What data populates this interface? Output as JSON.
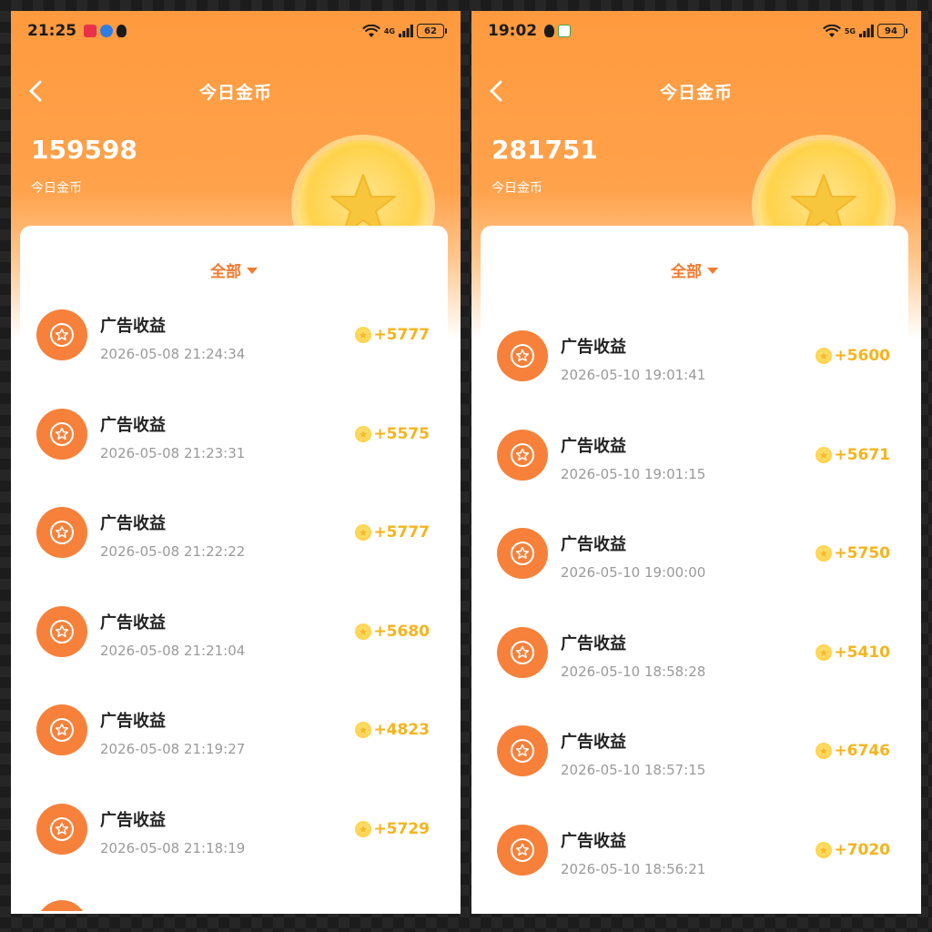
{
  "colors": {
    "header_orange": "#ff9a3e",
    "icon_orange": "#f7813a",
    "accent_orange": "#f37a2e",
    "coin_gold": "#ffd24a",
    "amount_gold": "#f6b41c"
  },
  "panels": [
    {
      "status": {
        "time": "21:25",
        "network": "4G",
        "battery": "62"
      },
      "nav": {
        "title": "今日金币"
      },
      "summary": {
        "total": "159598",
        "label": "今日金币"
      },
      "filter": {
        "label": "全部"
      },
      "rows": [
        {
          "title": "广告收益",
          "time": "2026-05-08 21:24:34",
          "amount": "+5777"
        },
        {
          "title": "广告收益",
          "time": "2026-05-08 21:23:31",
          "amount": "+5575"
        },
        {
          "title": "广告收益",
          "time": "2026-05-08 21:22:22",
          "amount": "+5777"
        },
        {
          "title": "广告收益",
          "time": "2026-05-08 21:21:04",
          "amount": "+5680"
        },
        {
          "title": "广告收益",
          "time": "2026-05-08 21:19:27",
          "amount": "+4823"
        },
        {
          "title": "广告收益",
          "time": "2026-05-08 21:18:19",
          "amount": "+5729"
        }
      ]
    },
    {
      "status": {
        "time": "19:02",
        "network": "5G",
        "battery": "94"
      },
      "nav": {
        "title": "今日金币"
      },
      "summary": {
        "total": "281751",
        "label": "今日金币"
      },
      "filter": {
        "label": "全部"
      },
      "rows": [
        {
          "title": "广告收益",
          "time": "2026-05-10 19:01:41",
          "amount": "+5600"
        },
        {
          "title": "广告收益",
          "time": "2026-05-10 19:01:15",
          "amount": "+5671"
        },
        {
          "title": "广告收益",
          "time": "2026-05-10 19:00:00",
          "amount": "+5750"
        },
        {
          "title": "广告收益",
          "time": "2026-05-10 18:58:28",
          "amount": "+5410"
        },
        {
          "title": "广告收益",
          "time": "2026-05-10 18:57:15",
          "amount": "+6746"
        },
        {
          "title": "广告收益",
          "time": "2026-05-10 18:56:21",
          "amount": "+7020"
        }
      ]
    }
  ]
}
